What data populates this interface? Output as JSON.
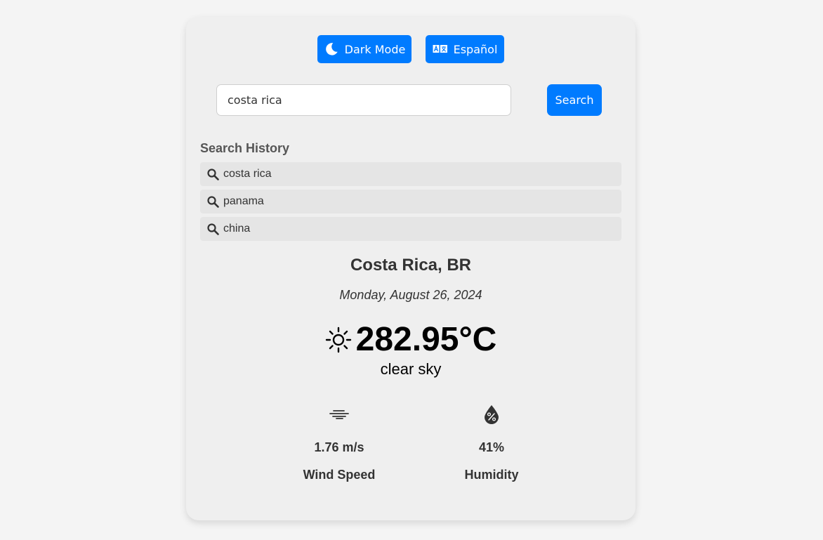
{
  "toolbar": {
    "dark_mode_label": "Dark Mode",
    "language_label": "Español"
  },
  "search": {
    "value": "costa rica",
    "button_label": "Search"
  },
  "history": {
    "title": "Search History",
    "items": [
      {
        "label": "costa rica"
      },
      {
        "label": "panama"
      },
      {
        "label": "china"
      }
    ]
  },
  "weather": {
    "location": "Costa Rica, BR",
    "date": "Monday, August 26, 2024",
    "temperature": "282.95°C",
    "description": "clear sky",
    "icon": "sun-icon"
  },
  "stats": {
    "wind": {
      "value": "1.76 m/s",
      "label": "Wind Speed",
      "icon": "wind-icon"
    },
    "humidity": {
      "value": "41%",
      "label": "Humidity",
      "icon": "humidity-icon"
    }
  },
  "colors": {
    "accent": "#007bff",
    "background": "#f4f4f4",
    "card": "#efefef",
    "history_item": "#e5e5e5"
  }
}
